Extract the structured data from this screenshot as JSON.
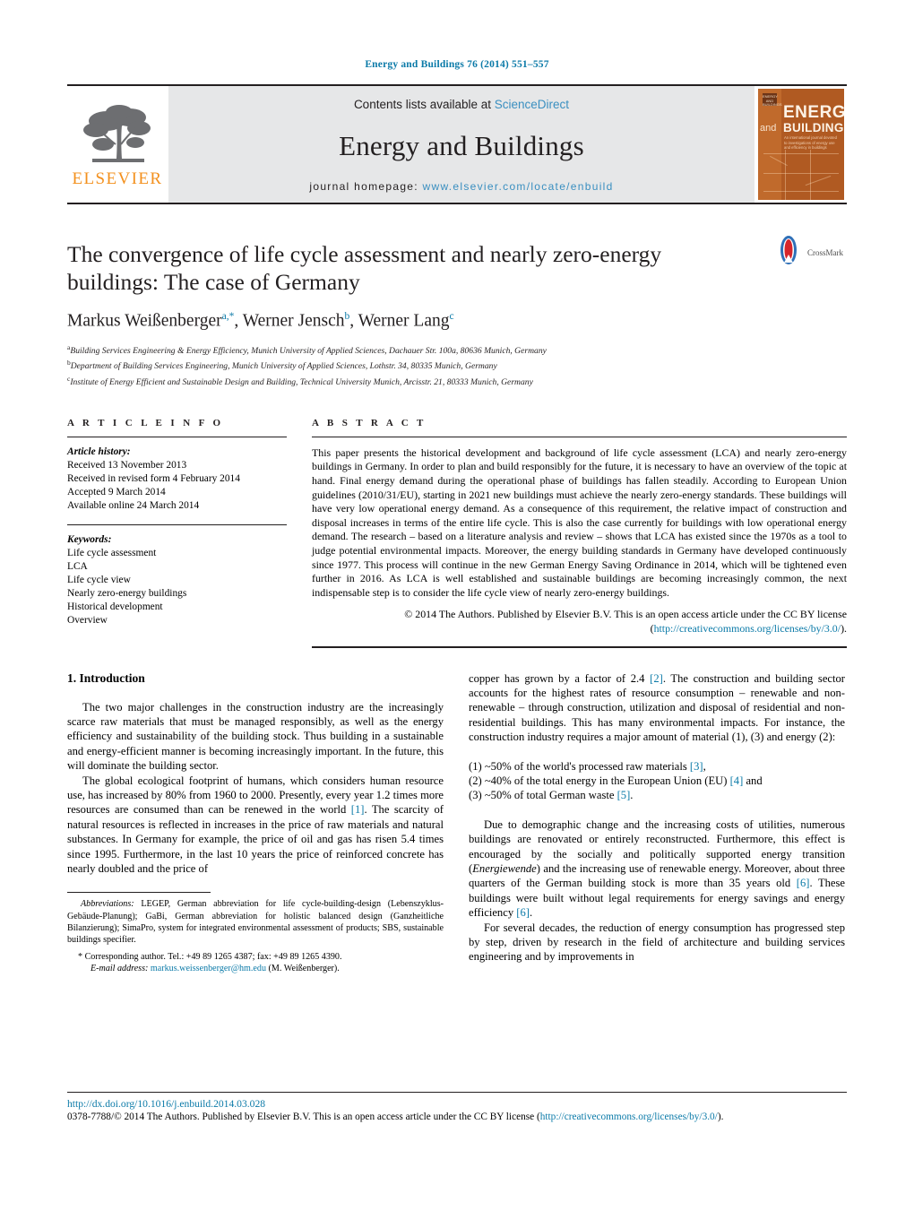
{
  "running_head": "Energy and Buildings 76 (2014) 551–557",
  "masthead": {
    "contents_prefix": "Contents lists available at ",
    "sciencedirect": "ScienceDirect",
    "journal_name": "Energy and Buildings",
    "homepage_label": "journal homepage:",
    "homepage_url": "www.elsevier.com/locate/enbuild",
    "publisher_wordmark": "ELSEVIER",
    "publisher_logo_icon": "elsevier-tree-icon",
    "cover": {
      "badge_text": "ENERGY AND BUILDINGS",
      "and": "and",
      "energy": "ENERGY",
      "buildings": "BUILDINGS",
      "subtitle": "An international journal devoted to investigations of energy use and efficiency in buildings"
    }
  },
  "article": {
    "title": "The convergence of life cycle assessment and nearly zero-energy buildings: The case of Germany",
    "authors_html": "Markus Weißenberger<sup>a,*</sup>, Werner Jensch<sup>b</sup>, Werner Lang<sup>c</sup>",
    "affiliations": [
      {
        "marker": "a",
        "text": "Building Services Engineering & Energy Efficiency, Munich University of Applied Sciences, Dachauer Str. 100a, 80636 Munich, Germany"
      },
      {
        "marker": "b",
        "text": "Department of Building Services Engineering, Munich University of Applied Sciences, Lothstr. 34, 80335 Munich, Germany"
      },
      {
        "marker": "c",
        "text": "Institute of Energy Efficient and Sustainable Design and Building, Technical University Munich, Arcisstr. 21, 80333 Munich, Germany"
      }
    ],
    "crossmark_label": "CrossMark",
    "crossmark_icon": "crossmark-icon"
  },
  "article_info": {
    "heading": "A R T I C L E    I N F O",
    "history_title": "Article history:",
    "history": [
      "Received 13 November 2013",
      "Received in revised form 4 February 2014",
      "Accepted 9 March 2014",
      "Available online 24 March 2014"
    ],
    "keywords_title": "Keywords:",
    "keywords": [
      "Life cycle assessment",
      "LCA",
      "Life cycle view",
      "Nearly zero-energy buildings",
      "Historical development",
      "Overview"
    ]
  },
  "abstract": {
    "heading": "A B S T R A C T",
    "text": "This paper presents the historical development and background of life cycle assessment (LCA) and nearly zero-energy buildings in Germany. In order to plan and build responsibly for the future, it is necessary to have an overview of the topic at hand. Final energy demand during the operational phase of buildings has fallen steadily. According to European Union guidelines (2010/31/EU), starting in 2021 new buildings must achieve the nearly zero-energy standards. These buildings will have very low operational energy demand. As a consequence of this requirement, the relative impact of construction and disposal increases in terms of the entire life cycle. This is also the case currently for buildings with low operational energy demand. The research – based on a literature analysis and review – shows that LCA has existed since the 1970s as a tool to judge potential environmental impacts. Moreover, the energy building standards in Germany have developed continuously since 1977. This process will continue in the new German Energy Saving Ordinance in 2014, which will be tightened even further in 2016. As LCA is well established and sustainable buildings are becoming increasingly common, the next indispensable step is to consider the life cycle view of nearly zero-energy buildings.",
    "copyright": "© 2014 The Authors. Published by Elsevier B.V. This is an open access article under the CC BY license",
    "license_open": "(",
    "license_url": "http://creativecommons.org/licenses/by/3.0/",
    "license_close": ")."
  },
  "body": {
    "section_heading": "1. Introduction",
    "left_para_1": "The two major challenges in the construction industry are the increasingly scarce raw materials that must be managed responsibly, as well as the energy efficiency and sustainability of the building stock. Thus building in a sustainable and energy-efficient manner is becoming increasingly important. In the future, this will dominate the building sector.",
    "left_para_2_a": "The global ecological footprint of humans, which considers human resource use, has increased by 80% from 1960 to 2000. Presently, every year 1.2 times more resources are consumed than can be renewed in the world ",
    "left_para_2_ref": "[1]",
    "left_para_2_b": ". The scarcity of natural resources is reflected in increases in the price of raw materials and natural substances. In Germany for example, the price of oil and gas has risen 5.4 times since 1995. Furthermore, in the last 10 years the price of reinforced concrete has nearly doubled and the price of",
    "right_para_1_a": "copper has grown by a factor of 2.4 ",
    "right_para_1_ref": "[2]",
    "right_para_1_b": ". The construction and building sector accounts for the highest rates of resource consumption – renewable and non-renewable – through construction, utilization and disposal of residential and non-residential buildings. This has many environmental impacts. For instance, the construction industry requires a major amount of material (1), (3) and energy (2):",
    "list": [
      {
        "prefix": "(1) ~50% of the world's processed raw materials ",
        "ref": "[3]",
        "suffix": ","
      },
      {
        "prefix": "(2) ~40% of the total energy in the European Union (EU) ",
        "ref": "[4]",
        "suffix": " and"
      },
      {
        "prefix": "(3) ~50% of total German waste ",
        "ref": "[5]",
        "suffix": "."
      }
    ],
    "right_para_2_a": "Due to demographic change and the increasing costs of utilities, numerous buildings are renovated or entirely reconstructed. Furthermore, this effect is encouraged by the socially and politically supported energy transition (",
    "right_para_2_italic": "Energiewende",
    "right_para_2_b": ") and the increasing use of renewable energy. Moreover, about three quarters of the German building stock is more than 35 years old ",
    "right_para_2_ref1": "[6]",
    "right_para_2_c": ". These buildings were built without legal requirements for energy savings and energy efficiency ",
    "right_para_2_ref2": "[6]",
    "right_para_2_d": ".",
    "right_para_3": "For several decades, the reduction of energy consumption has progressed step by step, driven by research in the field of architecture and building services engineering and by improvements in"
  },
  "footnotes": {
    "abbrev_label": "Abbreviations:",
    "abbrev_text": "LEGEP, German abbreviation for life cycle-building-design (Lebenszyklus-Gebäude-Planung); GaBi, German abbreviation for holistic balanced design (Ganzheitliche Bilanzierung); SimaPro, system for integrated environmental assessment of products; SBS, sustainable buildings specifier.",
    "corresponding": "Corresponding author. Tel.: +49 89 1265 4387; fax: +49 89 1265 4390.",
    "email_label": "E-mail address:",
    "email": "markus.weissenberger@hm.edu",
    "email_suffix": "(M. Weißenberger)."
  },
  "footer": {
    "doi": "http://dx.doi.org/10.1016/j.enbuild.2014.03.028",
    "issn_line_a": "0378-7788/© 2014 The Authors. Published by Elsevier B.V. This is an open access article under the CC BY license (",
    "issn_url": "http://creativecommons.org/licenses/by/3.0/",
    "issn_line_b": ")."
  },
  "colors": {
    "link": "#0b7aa8",
    "elsevier_orange": "#f3901d",
    "masthead_grey": "#e6e7e8"
  }
}
